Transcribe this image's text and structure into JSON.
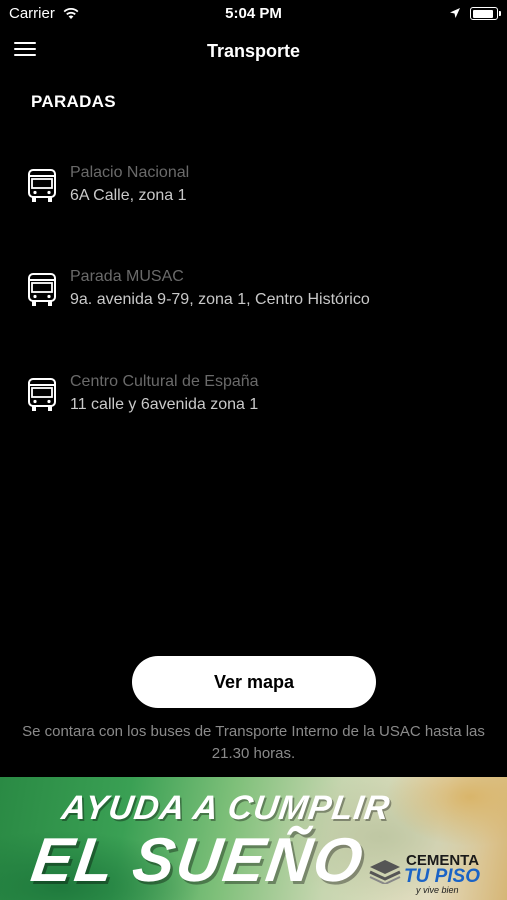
{
  "status_bar": {
    "carrier": "Carrier",
    "time": "5:04 PM",
    "icons": [
      "wifi-icon",
      "location-arrow-icon",
      "battery-icon"
    ],
    "battery_level": 0.95
  },
  "nav": {
    "title": "Transporte",
    "menu_icon": "hamburger-menu-icon"
  },
  "section_title": "PARADAS",
  "stops": [
    {
      "name": "Palacio Nacional",
      "address": "6A Calle, zona 1",
      "icon": "bus-icon"
    },
    {
      "name": "Parada MUSAC",
      "address": "9a. avenida 9-79, zona 1, Centro Histórico",
      "icon": "bus-icon"
    },
    {
      "name": "Centro Cultural de España",
      "address": "11 calle y 6avenida zona 1",
      "icon": "bus-icon"
    }
  ],
  "map_button": "Ver mapa",
  "note": "Se contara con los buses de Transporte Interno de la USAC hasta las 21.30 horas.",
  "banner": {
    "line1": "AYUDA A CUMPLIR",
    "line2": "EL SUEÑO",
    "brand_top": "CEMENTA",
    "brand_mid": "TU PISO",
    "brand_sub": "y vive bien"
  },
  "colors": {
    "background": "#000000",
    "stop_name": "#6a6a6a",
    "stop_address": "#c9c9c9",
    "button_bg": "#ffffff",
    "brand_blue": "#1a63c6"
  }
}
